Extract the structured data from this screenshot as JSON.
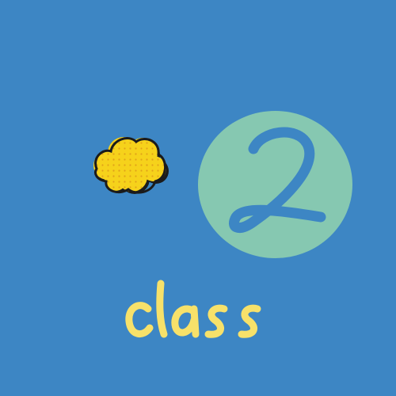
{
  "numeral": "2",
  "word": "class",
  "colors": {
    "background": "#3d86c4",
    "circle": "#86c8b1",
    "numeral": "#3d86c4",
    "cloud_fill": "#f6d21b",
    "cloud_outline": "#1b1b1b",
    "word": "#f7e16a"
  },
  "icons": [
    "popcorn-cloud-icon"
  ]
}
